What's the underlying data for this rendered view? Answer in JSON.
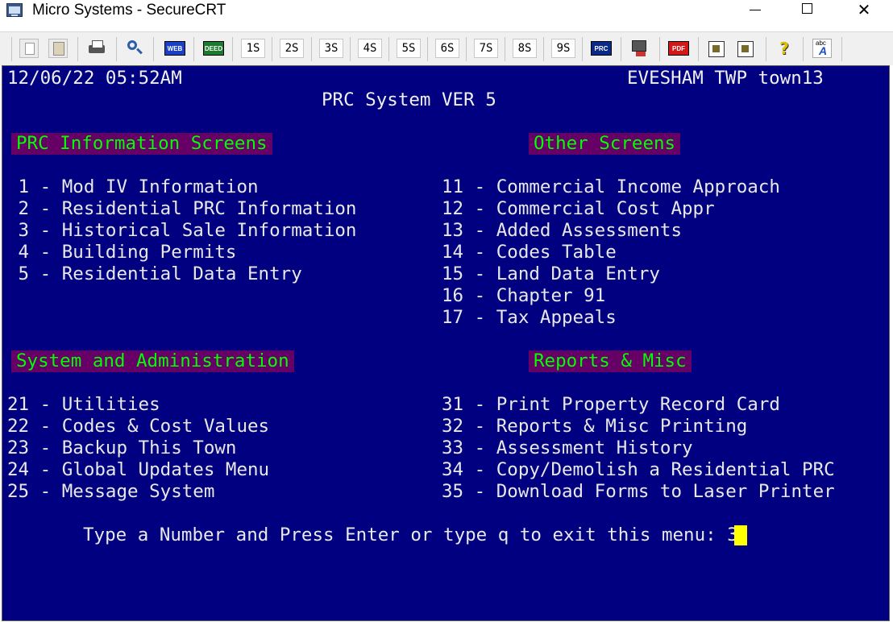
{
  "window": {
    "title": "Micro Systems - SecureCRT",
    "minimize_glyph": "—",
    "maximize_glyph": "□",
    "close_glyph": "✕"
  },
  "toolbar": {
    "icons": [
      "copy-icon",
      "paste-icon",
      "print-icon",
      "find-icon",
      "web-icon",
      "deed-icon",
      "prc-icon",
      "monitor-icon",
      "pdf-icon",
      "session-options-icon",
      "global-options-icon",
      "help-icon",
      "spell-check-icon"
    ],
    "web_label": "WEB",
    "deed_label": "DEED",
    "prc_label": "PRC",
    "pdf_label": "PDF",
    "spell_label": "abc",
    "sessions": [
      "1S",
      "2S",
      "3S",
      "4S",
      "5S",
      "6S",
      "7S",
      "8S",
      "9S"
    ],
    "colors": {
      "web": "#1a3fc9",
      "deed": "#1b7a2b",
      "prc": "#0a2a8a",
      "pdf": "#d41818",
      "help": "#e0c000"
    }
  },
  "terminal": {
    "colors": {
      "background": "#000080",
      "text": "#e8e8e8",
      "section_bg": "#660066",
      "section_text": "#00ff00",
      "cursor": "#ffff00"
    },
    "datetime": "12/06/22 05:52AM",
    "location": "EVESHAM TWP town13",
    "system_title": "PRC System VER 5",
    "sections": {
      "prc_info": "PRC Information Screens",
      "other": "Other Screens",
      "system_admin": "System and Administration",
      "reports": "Reports & Misc"
    },
    "prc_info_items": [
      " 1 - Mod IV Information",
      " 2 - Residential PRC Information",
      " 3 - Historical Sale Information",
      " 4 - Building Permits",
      " 5 - Residential Data Entry"
    ],
    "other_items": [
      "11 - Commercial Income Approach",
      "12 - Commercial Cost Appr",
      "13 - Added Assessments",
      "14 - Codes Table",
      "15 - Land Data Entry",
      "16 - Chapter 91",
      "17 - Tax Appeals"
    ],
    "admin_items": [
      "21 - Utilities",
      "22 - Codes & Cost Values",
      "23 - Backup This Town",
      "24 - Global Updates Menu",
      "25 - Message System"
    ],
    "report_items": [
      "31 - Print Property Record Card",
      "32 - Reports & Misc Printing",
      "33 - Assessment History",
      "34 - Copy/Demolish a Residential PRC",
      "35 - Download Forms to Laser Printer"
    ],
    "prompt": "Type a Number and Press Enter or type q to exit this menu: 3"
  }
}
